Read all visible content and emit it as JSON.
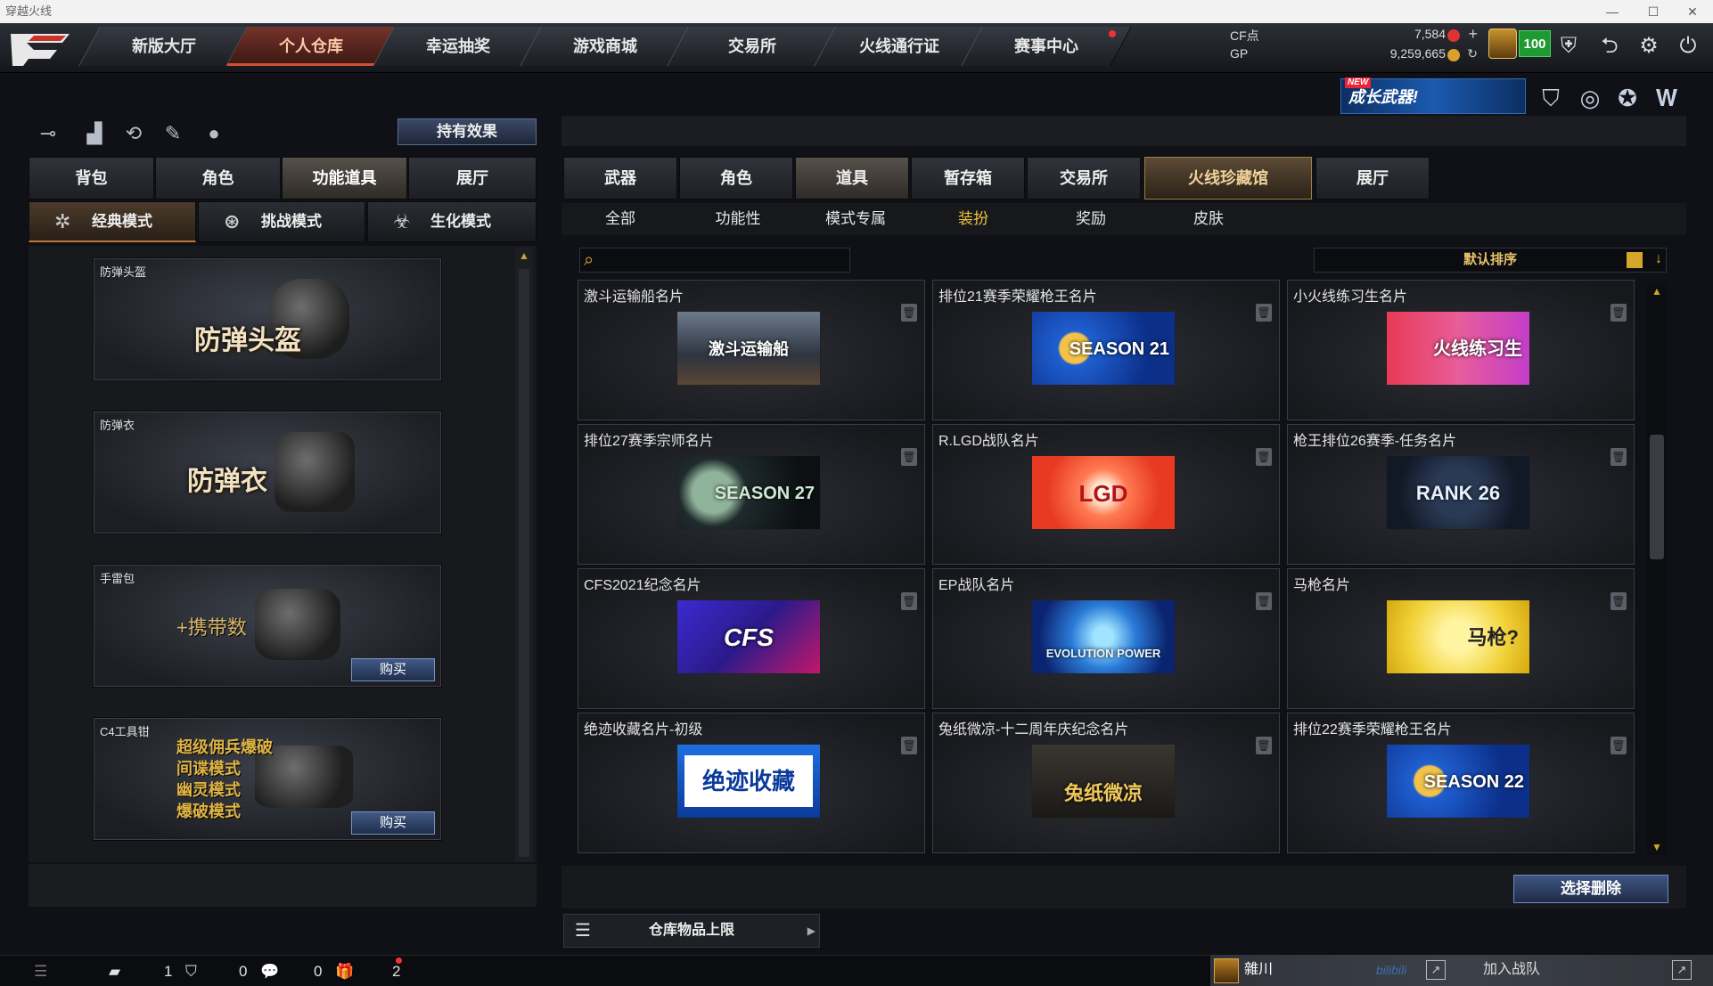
{
  "window": {
    "title": "穿越火线"
  },
  "nav": {
    "tabs": [
      {
        "label": "新版大厅"
      },
      {
        "label": "个人仓库"
      },
      {
        "label": "幸运抽奖"
      },
      {
        "label": "游戏商城"
      },
      {
        "label": "交易所"
      },
      {
        "label": "火线通行证"
      },
      {
        "label": "赛事中心"
      }
    ],
    "active": "个人仓库"
  },
  "currency": {
    "cf_label": "CF点",
    "cf_value": "7,584",
    "gp_label": "GP",
    "gp_value": "9,259,665",
    "level": "100"
  },
  "banner": {
    "new_badge": "NEW",
    "text": "成长武器!"
  },
  "left": {
    "effects_button": "持有效果",
    "tabs": [
      {
        "label": "背包"
      },
      {
        "label": "角色"
      },
      {
        "label": "功能道具"
      },
      {
        "label": "展厅"
      }
    ],
    "modes": [
      {
        "label": "经典模式"
      },
      {
        "label": "挑战模式"
      },
      {
        "label": "生化模式"
      }
    ],
    "cards": [
      {
        "name": "防弹头盔",
        "art": "防弹头盔"
      },
      {
        "name": "防弹衣",
        "art": "防弹衣"
      },
      {
        "name": "手雷包",
        "art": "+携带数",
        "buy": "购买"
      },
      {
        "name": "C4工具钳",
        "lines": [
          "超级佣兵爆破",
          "间谍模式",
          "幽灵模式",
          "爆破模式"
        ],
        "buy": "购买"
      }
    ]
  },
  "right": {
    "tabs": [
      {
        "label": "武器"
      },
      {
        "label": "角色"
      },
      {
        "label": "道具"
      },
      {
        "label": "暂存箱"
      },
      {
        "label": "交易所"
      },
      {
        "label": "火线珍藏馆"
      },
      {
        "label": "展厅"
      }
    ],
    "subtabs": [
      {
        "label": "全部"
      },
      {
        "label": "功能性"
      },
      {
        "label": "模式专属"
      },
      {
        "label": "装扮"
      },
      {
        "label": "奖励"
      },
      {
        "label": "皮肤"
      }
    ],
    "active_subtab": "装扮",
    "search_placeholder": "",
    "sort_label": "默认排序",
    "items": [
      {
        "name": "激斗运输船名片",
        "art": "激斗运输船"
      },
      {
        "name": "排位21赛季荣耀枪王名片",
        "art": "SEASON 21"
      },
      {
        "name": "小火线练习生名片",
        "art": "火线练习生"
      },
      {
        "name": "排位27赛季宗师名片",
        "art": "SEASON 27"
      },
      {
        "name": "R.LGD战队名片",
        "art": "LGD"
      },
      {
        "name": "枪王排位26赛季-任务名片",
        "art": "RANK 26"
      },
      {
        "name": "CFS2021纪念名片",
        "art": "CFS"
      },
      {
        "name": "EP战队名片",
        "art": "EVOLUTION POWER"
      },
      {
        "name": "马枪名片",
        "art": "马枪?"
      },
      {
        "name": "绝迹收藏名片-初级",
        "art": "绝迹收藏"
      },
      {
        "name": "兔纸微凉-十二周年庆纪念名片",
        "art": "兔纸微凉"
      },
      {
        "name": "排位22赛季荣耀枪王名片",
        "art": "SEASON 22"
      }
    ],
    "delete_button": "选择删除",
    "storage_limit": "仓库物品上限"
  },
  "status": {
    "count1": "1",
    "count2": "0",
    "count3": "0",
    "count4": "2",
    "player_name": "雜川",
    "join_team": "加入战队",
    "bili": "bilibili"
  },
  "colors": {
    "accent_gold": "#f0c23c",
    "active_nav": "#74332a",
    "level_green": "#1f9a33"
  }
}
